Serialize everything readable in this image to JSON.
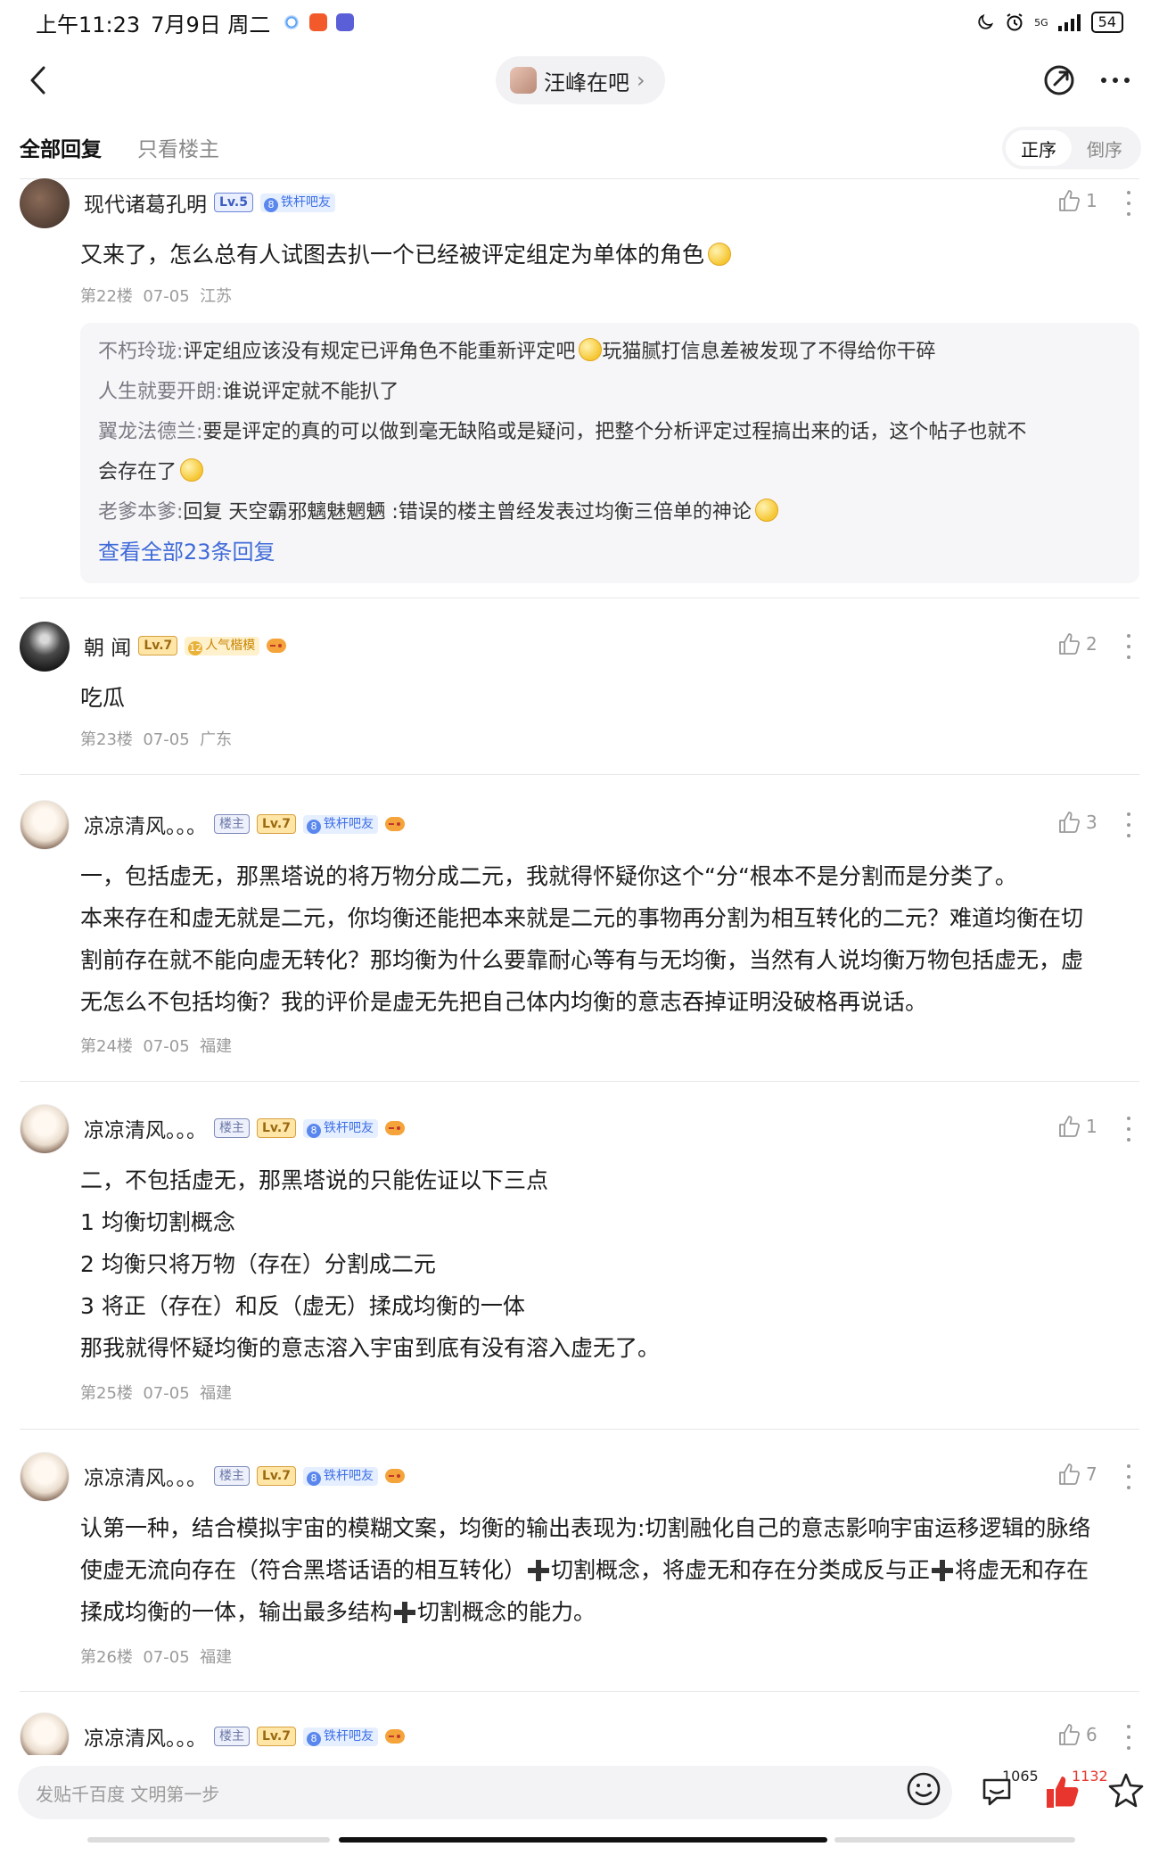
{
  "status_bar": {
    "time": "上午11:23",
    "date": "7月9日 周二",
    "signal": "5G",
    "battery": "54"
  },
  "nav": {
    "forum_name": "汪峰在吧",
    "chevron": "›"
  },
  "tabs": {
    "all_replies": "全部回复",
    "only_op": "只看楼主",
    "order_asc": "正序",
    "order_desc": "倒序"
  },
  "posts": [
    {
      "username": "现代诸葛孔明",
      "level": "Lv.5",
      "tag_num": "8",
      "tag": "铁杆吧友",
      "likes": "1",
      "content": "又来了，怎么总有人试图去扒一个已经被评定组定为单体的角色",
      "floor": "第22楼",
      "date": "07-05",
      "location": "江苏",
      "replies": [
        {
          "name": "不朽玲珑:",
          "text": "评定组应该没有规定已评角色不能重新评定吧"
        },
        {
          "text_after_emoji": "玩猫腻打信息差被发现了不得给你干碎"
        },
        {
          "name": "人生就要开朗:",
          "text": "谁说评定就不能扒了"
        },
        {
          "name": "翼龙法德兰:",
          "text": "要是评定的真的可以做到毫无缺陷或是疑问，把整个分析评定过程搞出来的话，这个帖子也就不"
        },
        {
          "text": "会存在了"
        },
        {
          "name": "老爹本爹:",
          "text": "回复 天空霸邪魑魅魍魉 :错误的楼主曾经发表过均衡三倍单的神论"
        }
      ],
      "view_all": "查看全部23条回复"
    },
    {
      "username": "朝 闻",
      "level": "Lv.7",
      "tag_num": "12",
      "tag": "人气楷模",
      "likes": "2",
      "content": "吃瓜",
      "floor": "第23楼",
      "date": "07-05",
      "location": "广东"
    },
    {
      "username": "凉凉清风。。。",
      "owner_badge": "楼主",
      "level": "Lv.7",
      "tag_num": "8",
      "tag": "铁杆吧友",
      "likes": "3",
      "content_lines": [
        "一，包括虚无，那黑塔说的将万物分成二元，我就得怀疑你这个“分“根本不是分割而是分类了。",
        "本来存在和虚无就是二元，你均衡还能把本来就是二元的事物再分割为相互转化的二元？难道均衡在切",
        "割前存在就不能向虚无转化？那均衡为什么要靠耐心等有与无均衡，当然有人说均衡万物包括虚无，虚",
        "无怎么不包括均衡？我的评价是虚无先把自己体内均衡的意志吞掉证明没破格再说话。"
      ],
      "floor": "第24楼",
      "date": "07-05",
      "location": "福建"
    },
    {
      "username": "凉凉清风。。。",
      "owner_badge": "楼主",
      "level": "Lv.7",
      "tag_num": "8",
      "tag": "铁杆吧友",
      "likes": "1",
      "content_lines": [
        "二，不包括虚无，那黑塔说的只能佐证以下三点",
        "1 均衡切割概念",
        "2 均衡只将万物（存在）分割成二元",
        "3 将正（存在）和反（虚无）揉成均衡的一体",
        "那我就得怀疑均衡的意志溶入宇宙到底有没有溶入虚无了。"
      ],
      "floor": "第25楼",
      "date": "07-05",
      "location": "福建"
    },
    {
      "username": "凉凉清风。。。",
      "owner_badge": "楼主",
      "level": "Lv.7",
      "tag_num": "8",
      "tag": "铁杆吧友",
      "likes": "7",
      "content_line1": "认第一种，结合模拟宇宙的模糊文案，均衡的输出表现为:切割融化自己的意志影响宇宙运移逻辑的脉络",
      "content_line2a": "使虚无流向存在（符合黑塔话语的相互转化）",
      "content_line2b": "切割概念，将虚无和存在分类成反与正",
      "content_line2c": "将虚无和存在",
      "content_line3a": "揉成均衡的一体，输出最多结构",
      "content_line3b": "切割概念的能力。",
      "floor": "第26楼",
      "date": "07-05",
      "location": "福建"
    },
    {
      "username": "凉凉清风。。。",
      "owner_badge": "楼主",
      "level": "Lv.7",
      "tag_num": "8",
      "tag": "铁杆吧友",
      "likes": "6"
    }
  ],
  "bottom_bar": {
    "input_placeholder": "发贴千百度 文明第一步",
    "comment_count": "1065",
    "like_count": "1132"
  },
  "icons": {
    "back": "back-arrow-icon",
    "share": "share-icon",
    "more": "more-icon",
    "like": "thumb-up-icon",
    "post_more": "kebab-icon",
    "emoji": "smile-icon",
    "comment": "comment-icon",
    "big_like": "thumb-up-filled-icon",
    "favorite": "star-icon"
  },
  "colors": {
    "link_blue": "#3f6ad8",
    "like_red": "#e8352e",
    "level_gold": "#ffe6a6"
  }
}
